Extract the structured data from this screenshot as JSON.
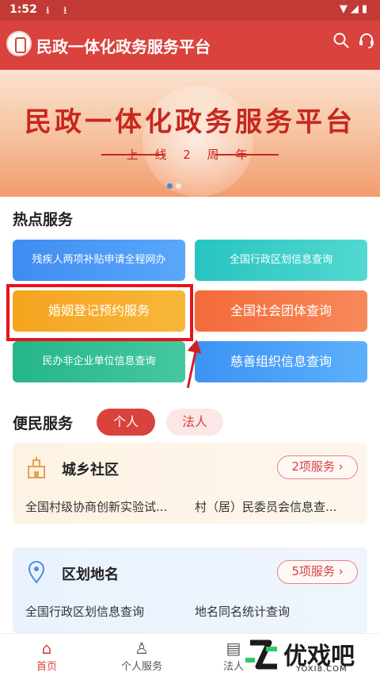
{
  "status_bar": {
    "time": "1:52"
  },
  "header": {
    "title": "民政一体化政务服务平台"
  },
  "banner": {
    "title": "民政一体化政务服务平台",
    "subtitle": "上 线 2 周 年"
  },
  "hot": {
    "title": "热点服务",
    "tiles": [
      {
        "label": "残疾人两项补贴申请全程网办"
      },
      {
        "label": "全国行政区划信息查询"
      },
      {
        "label": "婚姻登记预约服务"
      },
      {
        "label": "全国社会团体查询"
      },
      {
        "label": "民办非企业单位信息查询"
      },
      {
        "label": "慈善组织信息查询"
      }
    ]
  },
  "convenience": {
    "title": "便民服务",
    "tabs": [
      {
        "label": "个人"
      },
      {
        "label": "法人"
      }
    ],
    "cards": [
      {
        "title": "城乡社区",
        "count": "2项服务 ›",
        "items": [
          "全国村级协商创新实验试...",
          "村（居）民委员会信息查..."
        ]
      },
      {
        "title": "区划地名",
        "count": "5项服务 ›",
        "items": [
          "全国行政区划信息查询",
          "地名同名统计查询"
        ]
      }
    ]
  },
  "nav": [
    {
      "label": "首页"
    },
    {
      "label": "个人服务"
    },
    {
      "label": "法人"
    }
  ],
  "watermark": {
    "brand": "优戏吧",
    "domain": "YOXI8.COM"
  },
  "colors": {
    "brand_red": "#d9423d",
    "highlight_red": "#e5151b"
  }
}
